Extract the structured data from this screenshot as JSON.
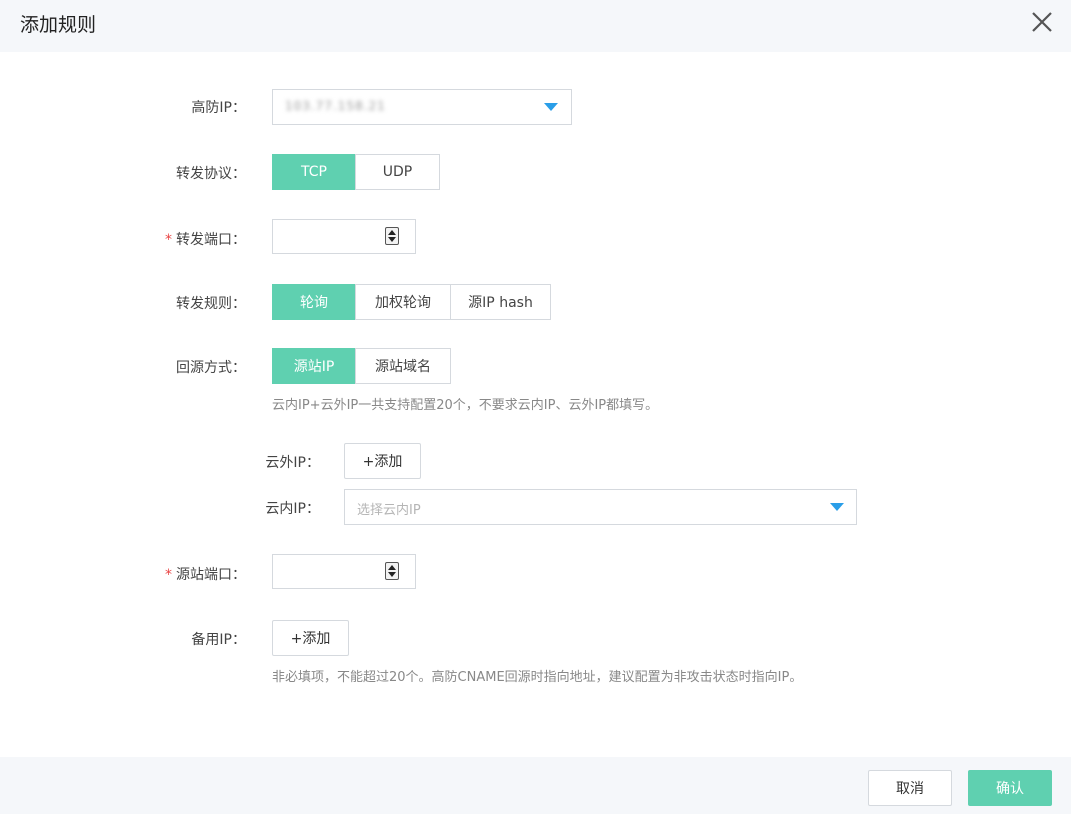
{
  "dialog": {
    "title": "添加规则"
  },
  "ddos_ip": {
    "label": "高防IP：",
    "value": "103.77.158.21"
  },
  "protocol": {
    "label": "转发协议：",
    "options": [
      "TCP",
      "UDP"
    ],
    "selected": "TCP"
  },
  "forward_port": {
    "required_mark": "*",
    "label": "转发端口：",
    "value": ""
  },
  "forward_rule": {
    "label": "转发规则：",
    "options": [
      "轮询",
      "加权轮询",
      "源IP hash"
    ],
    "selected": "轮询"
  },
  "origin_mode": {
    "label": "回源方式：",
    "options": [
      "源站IP",
      "源站域名"
    ],
    "selected": "源站IP",
    "hint": "云内IP+云外IP一共支持配置20个，不要求云内IP、云外IP都填写。"
  },
  "external_ip": {
    "label": "云外IP：",
    "add_label": "+添加"
  },
  "internal_ip": {
    "label": "云内IP：",
    "placeholder": "选择云内IP"
  },
  "origin_port": {
    "required_mark": "*",
    "label": "源站端口：",
    "value": ""
  },
  "backup_ip": {
    "label": "备用IP：",
    "add_label": "+添加",
    "hint": "非必填项，不能超过20个。高防CNAME回源时指向地址，建议配置为非攻击状态时指向IP。"
  },
  "footer": {
    "cancel_label": "取消",
    "confirm_label": "确认"
  },
  "colors": {
    "accent": "#5fd0b0",
    "caret": "#2a9ee8",
    "required": "#e94343"
  }
}
